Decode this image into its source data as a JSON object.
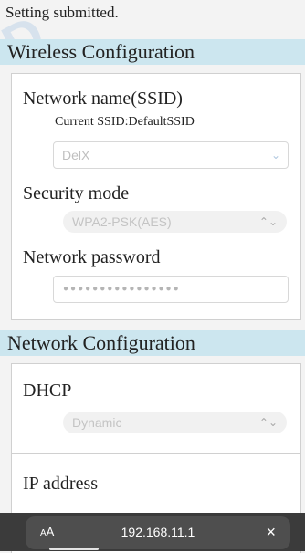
{
  "status": {
    "message": "Setting submitted."
  },
  "wireless": {
    "header": "Wireless Configuration",
    "ssid": {
      "label": "Network name(SSID)",
      "current": "Current SSID:DefaultSSID",
      "value": "DelX"
    },
    "security": {
      "label": "Security mode",
      "selected": "WPA2-PSK(AES)"
    },
    "password": {
      "label": "Network password",
      "masked": "●●●●●●●●●●●●●●●●"
    }
  },
  "network": {
    "header": "Network Configuration",
    "dhcp": {
      "label": "DHCP",
      "selected": "Dynamic"
    },
    "ip": {
      "label": "IP address"
    }
  },
  "browser": {
    "aa_label_big": "A",
    "aa_label_small": "A",
    "url": "192.168.11.1",
    "close_icon": "×"
  },
  "icons": {
    "chevron": "⌄",
    "updown": "⌃⌄"
  },
  "colors": {
    "section_header_bg": "#cce6ef",
    "url_bar_bg": "#3b3b3b"
  }
}
